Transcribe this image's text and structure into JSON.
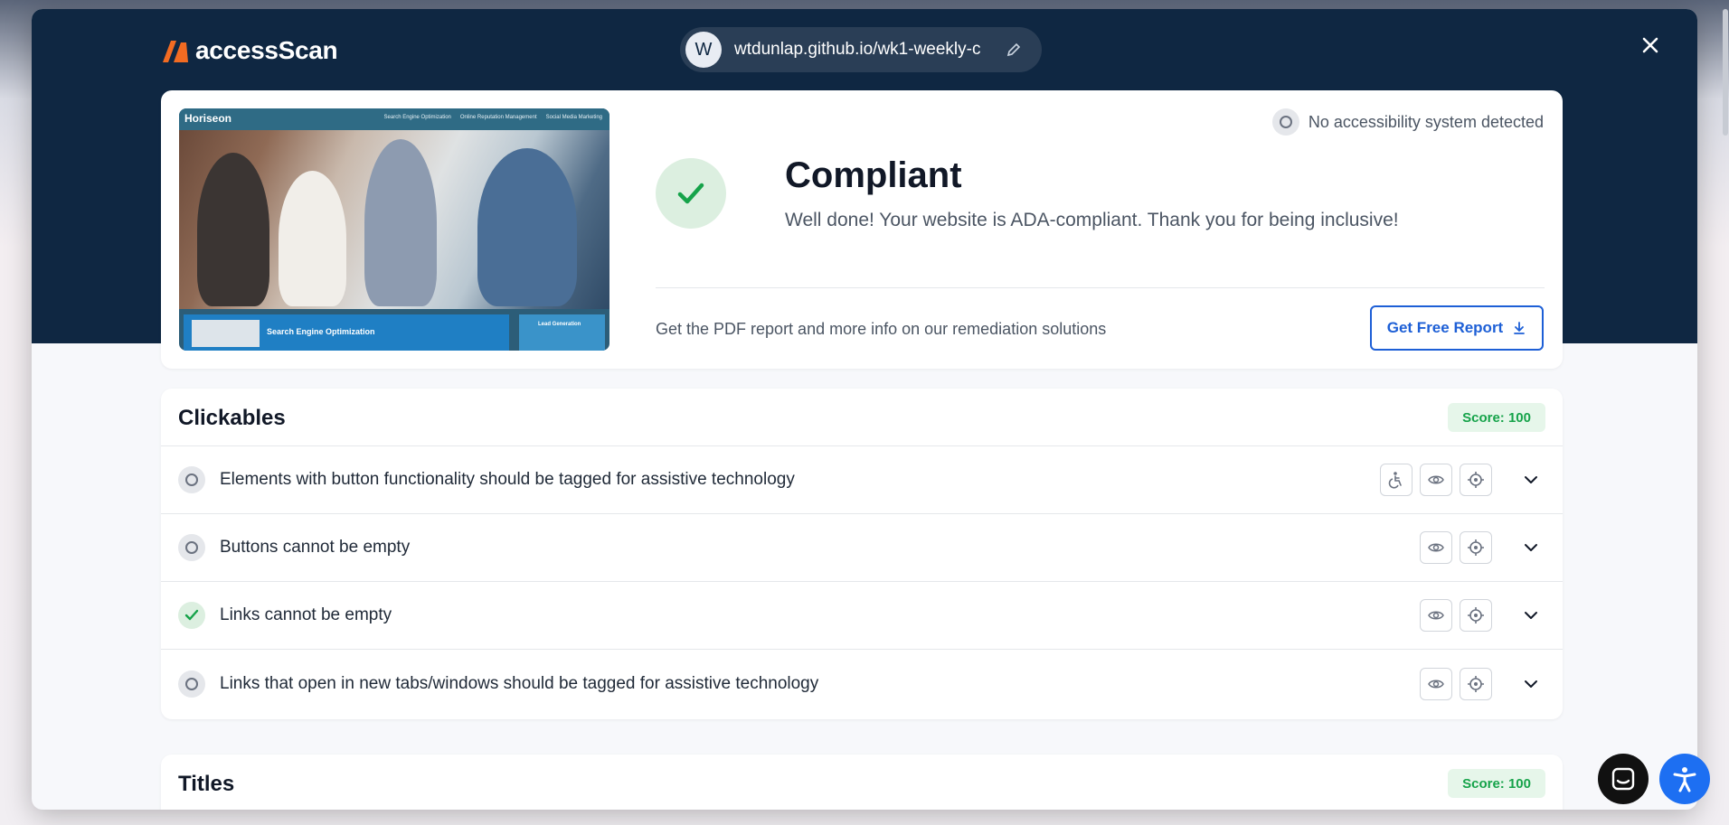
{
  "brand": {
    "name": "accessScan"
  },
  "url_bar": {
    "avatar_letter": "W",
    "url": "wtdunlap.github.io/wk1-weekly-c"
  },
  "preview": {
    "site_name": "Horiseon",
    "nav": [
      "Search Engine Optimization",
      "Online Reputation Management",
      "Social Media Marketing"
    ],
    "section_heading": "Search Engine Optimization",
    "side_heading": "Lead Generation"
  },
  "result": {
    "detection": "No accessibility system detected",
    "title": "Compliant",
    "subtitle": "Well done! Your website is ADA-compliant. Thank you for being inclusive!",
    "pdf_text": "Get the PDF report and more info on our remediation solutions",
    "report_button": "Get Free Report"
  },
  "sections": [
    {
      "title": "Clickables",
      "score": "Score: 100",
      "rows": [
        {
          "label": "Elements with button functionality should be tagged for assistive technology",
          "status": "neutral",
          "icons": [
            "accessibility-icon",
            "eye-icon",
            "target-icon"
          ]
        },
        {
          "label": "Buttons cannot be empty",
          "status": "neutral",
          "icons": [
            "eye-icon",
            "target-icon"
          ]
        },
        {
          "label": "Links cannot be empty",
          "status": "pass",
          "icons": [
            "eye-icon",
            "target-icon"
          ]
        },
        {
          "label": "Links that open in new tabs/windows should be tagged for assistive technology",
          "status": "neutral",
          "icons": [
            "eye-icon",
            "target-icon"
          ]
        }
      ]
    },
    {
      "title": "Titles",
      "score": "Score: 100"
    }
  ],
  "colors": {
    "navy": "#0f2742",
    "accent_blue": "#1d5fd6",
    "success_green": "#16a34a",
    "brand_orange": "#f26b22",
    "a11y_blue": "#1d6ff2"
  }
}
